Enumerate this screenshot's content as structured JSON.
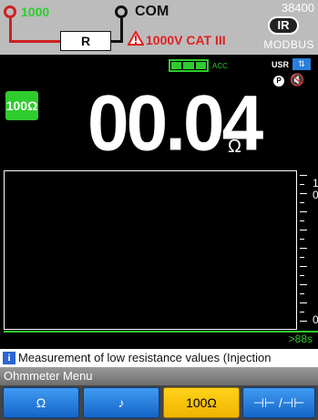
{
  "header": {
    "terminal_label": "1000",
    "com_label": "COM",
    "resistor_label": "R",
    "cat_rating": "1000V CAT III",
    "model": "38400",
    "ir_label": "IR",
    "modbus_label": "MODBUS"
  },
  "status": {
    "acc_label": "ACC",
    "battery_cells": 3,
    "usr_label": "USR",
    "usr_icon_glyph": "⇅",
    "p_label": "P",
    "mute_glyph": "🔇"
  },
  "measurement": {
    "range_badge": "100Ω",
    "value": "00.04",
    "unit": "Ω"
  },
  "graph": {
    "scale_top": "1",
    "scale_mid": "0",
    "scale_bottom": "0",
    "time_label": ">88s"
  },
  "info": {
    "icon_glyph": "i",
    "text": "Measurement of low resistance values (Injection"
  },
  "menu": {
    "title": "Ohmmeter Menu",
    "keys": [
      {
        "label": "Ω",
        "active": false
      },
      {
        "label": "♪",
        "active": false
      },
      {
        "label": "100Ω",
        "active": true
      },
      {
        "label": "⊣⊢ /⊣⊢",
        "active": false
      }
    ]
  },
  "colors": {
    "accent_green": "#2ecc2e",
    "wire_red": "#cc2222",
    "softkey_blue": "#1565c8",
    "softkey_active": "#f0b400"
  }
}
